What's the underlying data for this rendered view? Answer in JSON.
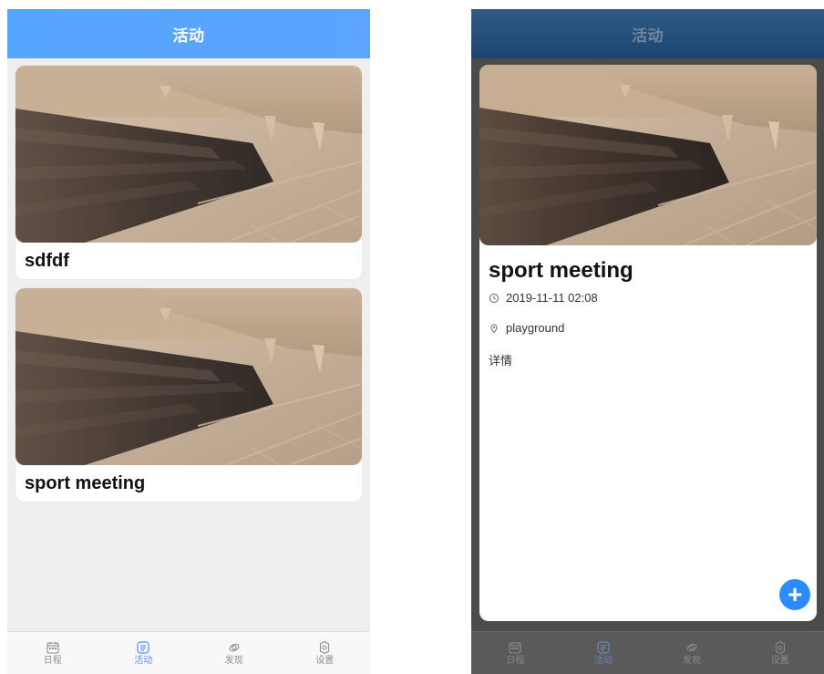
{
  "left_screen": {
    "header": {
      "title": "活动"
    },
    "activities": [
      {
        "title": "sdfdf",
        "image_icon": "photo-image"
      },
      {
        "title": "sport meeting",
        "image_icon": "photo-image"
      }
    ],
    "tabbar": {
      "items": [
        {
          "label": "日程",
          "icon": "calendar-icon",
          "active": false
        },
        {
          "label": "活动",
          "icon": "activity-icon",
          "active": true
        },
        {
          "label": "发现",
          "icon": "discover-icon",
          "active": false
        },
        {
          "label": "设置",
          "icon": "settings-icon",
          "active": false
        }
      ]
    }
  },
  "right_screen": {
    "header": {
      "title": "活动"
    },
    "detail": {
      "title": "sport meeting",
      "datetime": "2019-11-11 02:08",
      "location": "playground",
      "detail_label": "详情",
      "image_icon": "photo-image",
      "clock_icon": "clock-icon",
      "location_icon": "location-icon",
      "fab_label": "+",
      "fab_icon": "add-icon"
    },
    "tabbar": {
      "items": [
        {
          "label": "日程",
          "icon": "calendar-icon",
          "active": false
        },
        {
          "label": "活动",
          "icon": "activity-icon",
          "active": true
        },
        {
          "label": "发现",
          "icon": "discover-icon",
          "active": false
        },
        {
          "label": "设置",
          "icon": "settings-icon",
          "active": false
        }
      ]
    }
  },
  "colors": {
    "left_header": "#56a5ff",
    "right_header": "#2f5b86",
    "active_tab": "#4f8dff",
    "fab": "#2c8cff"
  }
}
